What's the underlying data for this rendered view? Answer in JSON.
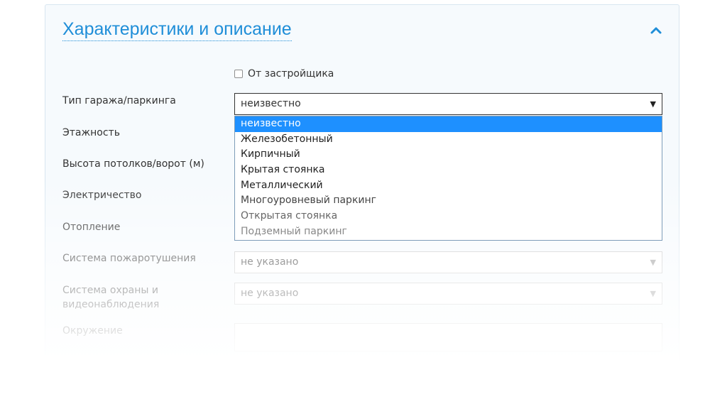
{
  "section": {
    "title": "Характеристики и описание"
  },
  "developer_checkbox": {
    "label": "От застройщика",
    "checked": false
  },
  "fields": {
    "garage_type": {
      "label": "Тип гаража/паркинга",
      "value": "неизвестно"
    },
    "floors": {
      "label": "Этажность"
    },
    "ceiling_height": {
      "label": "Высота потолков/ворот (м)"
    },
    "electricity": {
      "label": "Электричество"
    },
    "heating": {
      "label": "Отопление"
    },
    "fire_system": {
      "label": "Система пожаротушения",
      "value": "не указано"
    },
    "security_system": {
      "label_line1": "Система охраны и",
      "label_line2": "видеонаблюдения",
      "value": "не указано"
    },
    "surroundings": {
      "label": "Окружение"
    }
  },
  "dropdown": {
    "options": [
      "неизвестно",
      "Железобетонный",
      "Кирпичный",
      "Крытая стоянка",
      "Металлический",
      "Многоуровневый паркинг",
      "Открытая стоянка",
      "Подземный паркинг"
    ],
    "selected": "неизвестно"
  },
  "icons": {
    "collapse": "chevron-up-icon",
    "select_arrow": "triangle-down-icon"
  },
  "colors": {
    "accent": "#1f8ed8",
    "selection": "#1e90ff"
  }
}
